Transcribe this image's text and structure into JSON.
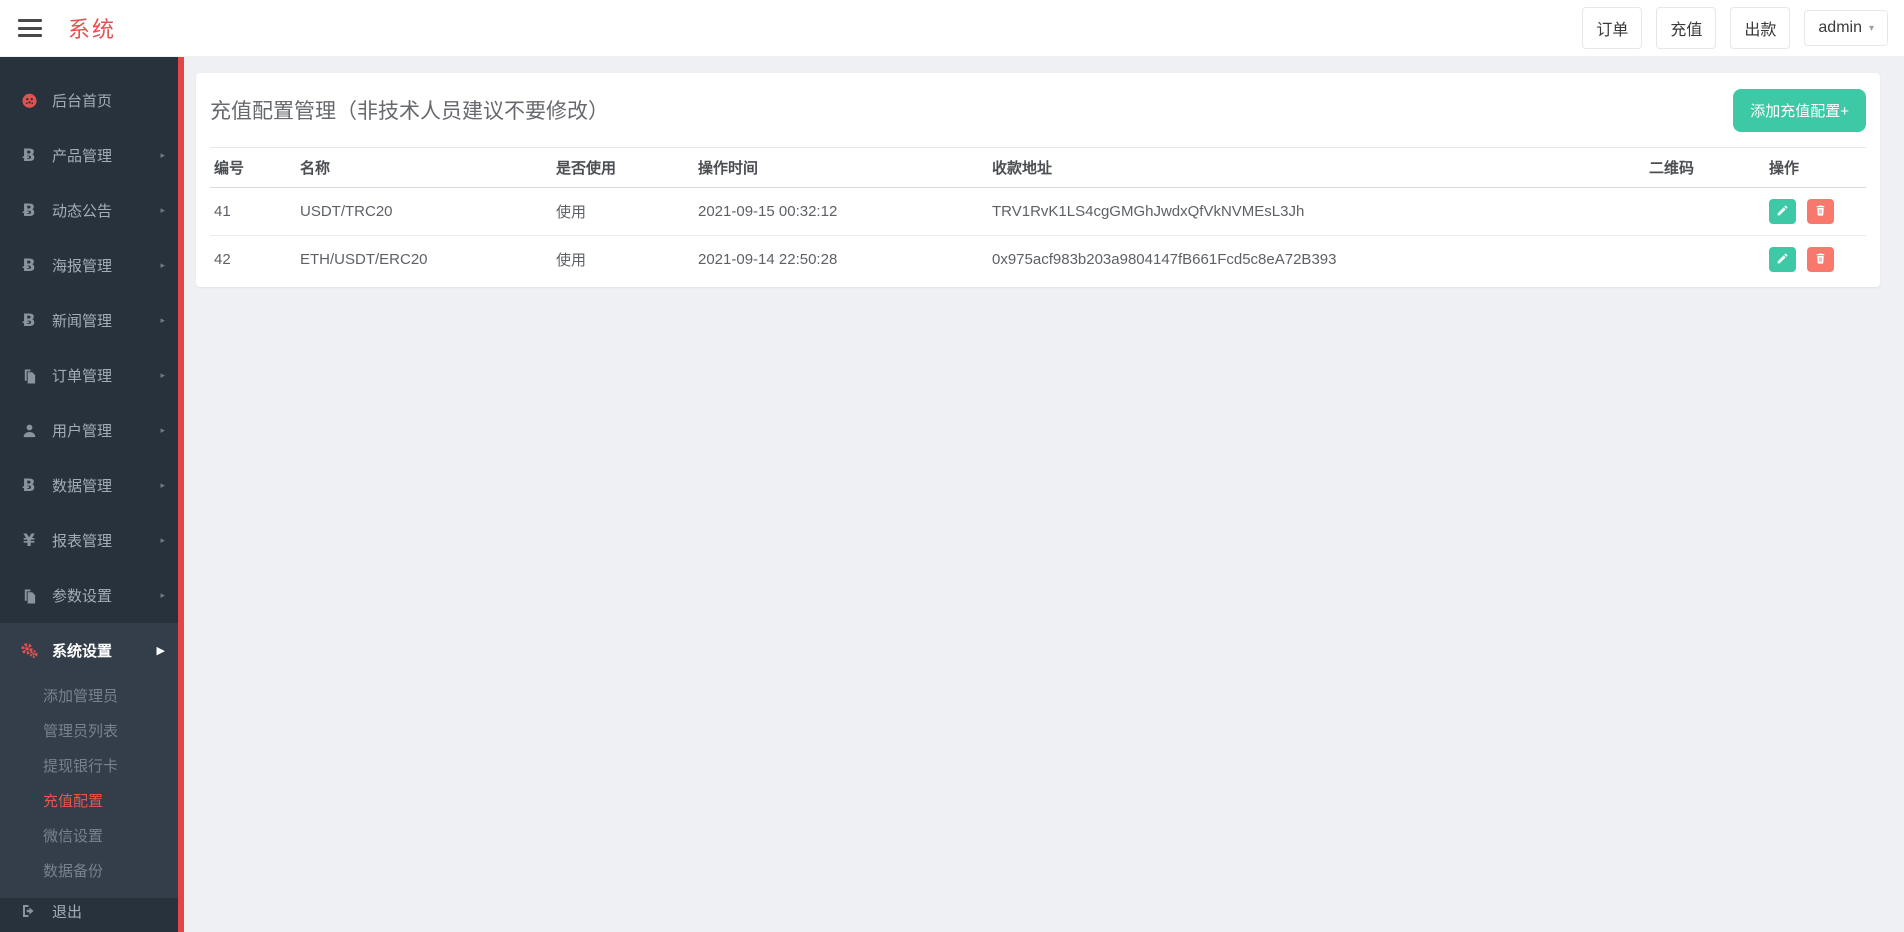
{
  "header": {
    "brand": "系统",
    "nav": {
      "orders": "订单",
      "recharge": "充值",
      "payout": "出款"
    },
    "user": {
      "name": "admin"
    }
  },
  "sidebar": {
    "items": [
      {
        "label": "后台首页",
        "icon": "dashboard-icon",
        "expandable": false,
        "active": false
      },
      {
        "label": "产品管理",
        "icon": "bitcoin-icon",
        "expandable": true,
        "active": false
      },
      {
        "label": "动态公告",
        "icon": "bitcoin-icon",
        "expandable": true,
        "active": false
      },
      {
        "label": "海报管理",
        "icon": "bitcoin-icon",
        "expandable": true,
        "active": false
      },
      {
        "label": "新闻管理",
        "icon": "bitcoin-icon",
        "expandable": true,
        "active": false
      },
      {
        "label": "订单管理",
        "icon": "copy-icon",
        "expandable": true,
        "active": false
      },
      {
        "label": "用户管理",
        "icon": "user-icon",
        "expandable": true,
        "active": false
      },
      {
        "label": "数据管理",
        "icon": "bitcoin-icon",
        "expandable": true,
        "active": false
      },
      {
        "label": "报表管理",
        "icon": "yen-icon",
        "expandable": true,
        "active": false
      },
      {
        "label": "参数设置",
        "icon": "copy-icon",
        "expandable": true,
        "active": false
      },
      {
        "label": "系统设置",
        "icon": "gears-icon",
        "expandable": true,
        "active": true
      }
    ],
    "submenu": {
      "items": [
        "添加管理员",
        "管理员列表",
        "提现银行卡",
        "充值配置",
        "微信设置",
        "数据备份"
      ],
      "active": "充值配置"
    },
    "logout": "退出",
    "icon_glyphs": {
      "bitcoin": "Ƀ",
      "yen": "¥",
      "chevron": "▸",
      "chevron_open": "▶"
    }
  },
  "main": {
    "title": "充值配置管理（非技术人员建议不要修改）",
    "add_button": "添加充值配置+",
    "table": {
      "headers": {
        "id": "编号",
        "name": "名称",
        "in_use": "是否使用",
        "time": "操作时间",
        "address": "收款地址",
        "qrcode": "二维码",
        "actions": "操作"
      },
      "rows": [
        {
          "id": "41",
          "name": "USDT/TRC20",
          "in_use": "使用",
          "time": "2021-09-15 00:32:12",
          "address": "TRV1RvK1LS4cgGMGhJwdxQfVkNVMEsL3Jh",
          "qrcode": ""
        },
        {
          "id": "42",
          "name": "ETH/USDT/ERC20",
          "in_use": "使用",
          "time": "2021-09-14 22:50:28",
          "address": "0x975acf983b203a9804147fB661Fcd5c8eA72B393",
          "qrcode": ""
        }
      ]
    }
  },
  "colors": {
    "accent_red": "#e25150",
    "stripe_red": "#e14747",
    "teal": "#3ec9a6",
    "salmon_red": "#f8786e",
    "sidebar_bg": "#28323d",
    "submenu_bg": "#333e4a",
    "page_bg": "#eef0f3"
  }
}
